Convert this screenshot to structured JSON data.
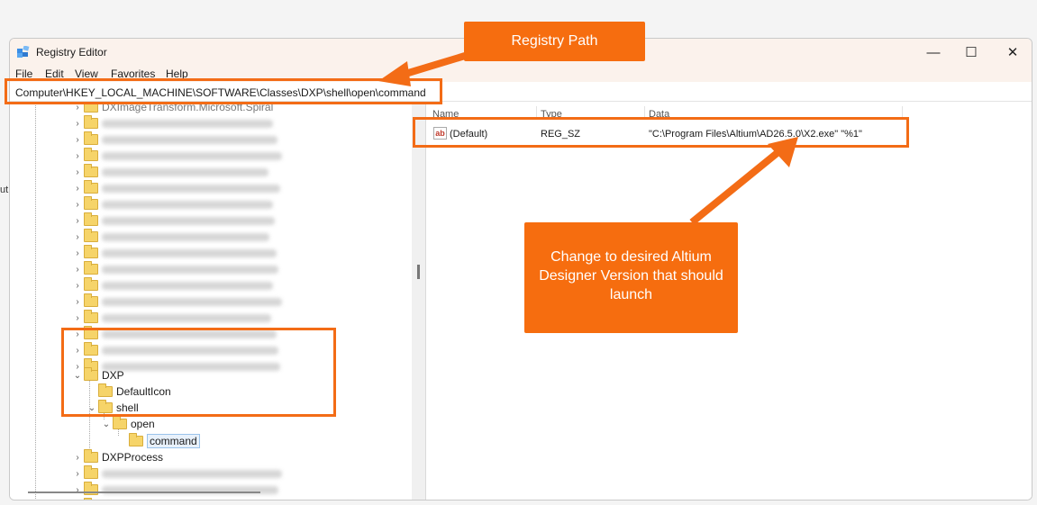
{
  "window": {
    "title": "Registry Editor",
    "controls": {
      "minimize": "—",
      "maximize": "☐",
      "close": "✕"
    }
  },
  "menu": [
    "File",
    "Edit",
    "View",
    "Favorites",
    "Help"
  ],
  "address": "Computer\\HKEY_LOCAL_MACHINE\\SOFTWARE\\Classes\\DXP\\shell\\open\\command",
  "columns": {
    "name": "Name",
    "type": "Type",
    "data": "Data"
  },
  "value_row": {
    "icon": "ab",
    "name": "(Default)",
    "type": "REG_SZ",
    "data": "\"C:\\Program Files\\Altium\\AD26.5.0\\X2.exe\" \"%1\""
  },
  "tree": {
    "partial_top": "DXImageTransform.Microsoft.Spiral",
    "dxp": "DXP",
    "default_icon": "DefaultIcon",
    "shell": "shell",
    "open": "open",
    "command": "command",
    "dxp_process": "DXPProcess"
  },
  "annotations": {
    "path_label": "Registry Path",
    "note": "Change to desired Altium Designer Version that should launch",
    "accent_color": "#f36c16"
  },
  "background_fragment": "ut"
}
